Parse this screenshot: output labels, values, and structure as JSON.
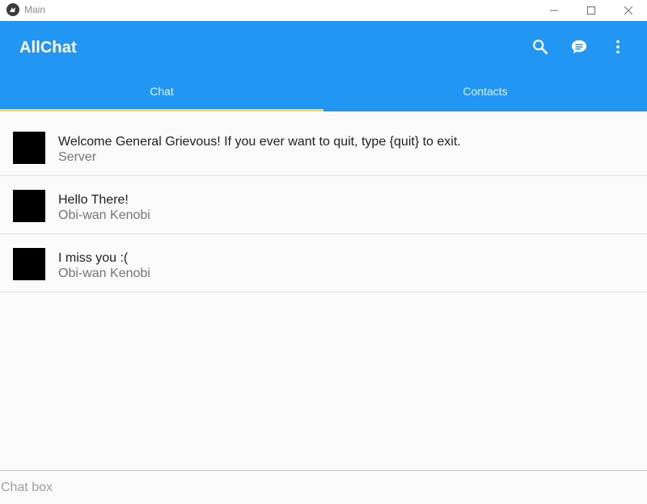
{
  "window": {
    "title": "Main",
    "icon": "kivy-logo-icon",
    "controls": [
      "minimize-icon",
      "maximize-icon",
      "close-icon"
    ]
  },
  "appbar": {
    "title": "AllChat",
    "color": "#2196f3",
    "actions": [
      "search-icon",
      "chat-bubble-icon",
      "more-vert-icon"
    ]
  },
  "tabs": {
    "items": [
      {
        "label": "Chat",
        "selected": true
      },
      {
        "label": "Contacts",
        "selected": false
      }
    ],
    "indicator_color": "#ffd740"
  },
  "messages": [
    {
      "text": "Welcome General Grievous! If you ever want to quit, type {quit} to exit.",
      "sender": "Server"
    },
    {
      "text": "Hello There!",
      "sender": "Obi-wan Kenobi"
    },
    {
      "text": "I miss you :(",
      "sender": "Obi-wan Kenobi"
    }
  ],
  "chatbox": {
    "placeholder": "Chat box",
    "value": ""
  }
}
